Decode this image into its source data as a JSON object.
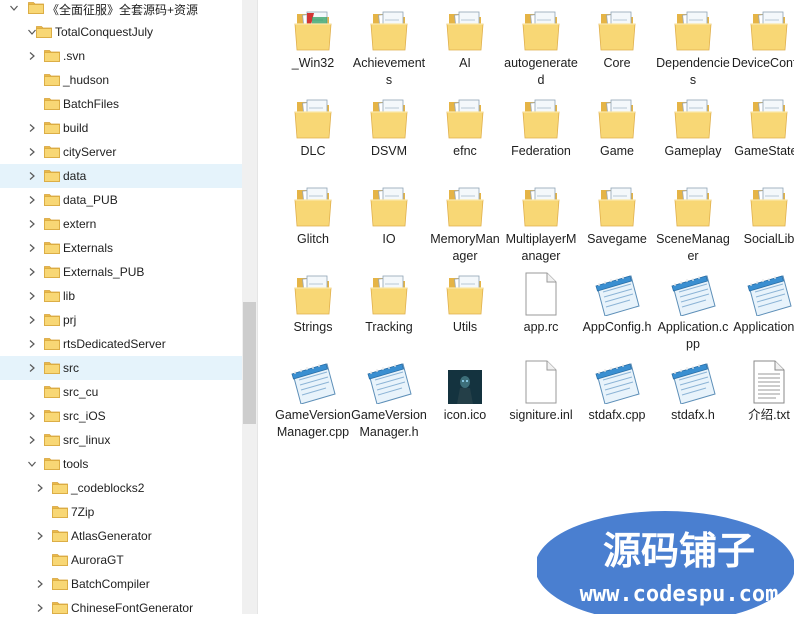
{
  "tree": {
    "items": [
      {
        "label": "《全面征服》全套源码+资源",
        "level": 0,
        "expander": "expanded",
        "selected": false
      },
      {
        "label": "TotalConquestJuly",
        "level": 1,
        "expander": "expanded",
        "selected": false
      },
      {
        "label": ".svn",
        "level": 2,
        "expander": "collapsed",
        "selected": false
      },
      {
        "label": "_hudson",
        "level": 2,
        "expander": "none",
        "selected": false
      },
      {
        "label": "BatchFiles",
        "level": 2,
        "expander": "none",
        "selected": false
      },
      {
        "label": "build",
        "level": 2,
        "expander": "collapsed",
        "selected": false
      },
      {
        "label": "cityServer",
        "level": 2,
        "expander": "collapsed",
        "selected": false
      },
      {
        "label": "data",
        "level": 2,
        "expander": "collapsed",
        "selected": true
      },
      {
        "label": "data_PUB",
        "level": 2,
        "expander": "collapsed",
        "selected": false
      },
      {
        "label": "extern",
        "level": 2,
        "expander": "collapsed",
        "selected": false
      },
      {
        "label": "Externals",
        "level": 2,
        "expander": "collapsed",
        "selected": false
      },
      {
        "label": "Externals_PUB",
        "level": 2,
        "expander": "collapsed",
        "selected": false
      },
      {
        "label": "lib",
        "level": 2,
        "expander": "collapsed",
        "selected": false
      },
      {
        "label": "prj",
        "level": 2,
        "expander": "collapsed",
        "selected": false
      },
      {
        "label": "rtsDedicatedServer",
        "level": 2,
        "expander": "collapsed",
        "selected": false
      },
      {
        "label": "src",
        "level": 2,
        "expander": "collapsed",
        "selected": true
      },
      {
        "label": "src_cu",
        "level": 2,
        "expander": "none",
        "selected": false
      },
      {
        "label": "src_iOS",
        "level": 2,
        "expander": "collapsed",
        "selected": false
      },
      {
        "label": "src_linux",
        "level": 2,
        "expander": "collapsed",
        "selected": false
      },
      {
        "label": "tools",
        "level": 2,
        "expander": "expanded",
        "selected": false
      },
      {
        "label": "_codeblocks2",
        "level": 3,
        "expander": "collapsed",
        "selected": false
      },
      {
        "label": "7Zip",
        "level": 3,
        "expander": "none",
        "selected": false
      },
      {
        "label": "AtlasGenerator",
        "level": 3,
        "expander": "collapsed",
        "selected": false
      },
      {
        "label": "AuroraGT",
        "level": 3,
        "expander": "none",
        "selected": false
      },
      {
        "label": "BatchCompiler",
        "level": 3,
        "expander": "collapsed",
        "selected": false
      },
      {
        "label": "ChineseFontGenerator",
        "level": 3,
        "expander": "collapsed",
        "selected": false
      }
    ]
  },
  "files": [
    {
      "name": "_Win32",
      "icon": "folder-red-doc-icon"
    },
    {
      "name": "Achievements",
      "icon": "folder-icon"
    },
    {
      "name": "AI",
      "icon": "folder-icon"
    },
    {
      "name": "autogenerated",
      "icon": "folder-icon"
    },
    {
      "name": "Core",
      "icon": "folder-icon"
    },
    {
      "name": "Dependencies",
      "icon": "folder-icon"
    },
    {
      "name": "DeviceConfig",
      "icon": "folder-icon"
    },
    {
      "name": "DLC",
      "icon": "folder-icon"
    },
    {
      "name": "DSVM",
      "icon": "folder-icon"
    },
    {
      "name": "efnc",
      "icon": "folder-icon"
    },
    {
      "name": "Federation",
      "icon": "folder-icon"
    },
    {
      "name": "Game",
      "icon": "folder-icon"
    },
    {
      "name": "Gameplay",
      "icon": "folder-icon"
    },
    {
      "name": "GameStates",
      "icon": "folder-icon"
    },
    {
      "name": "Glitch",
      "icon": "folder-icon"
    },
    {
      "name": "IO",
      "icon": "folder-icon"
    },
    {
      "name": "MemoryManager",
      "icon": "folder-icon"
    },
    {
      "name": "MultiplayerManager",
      "icon": "folder-icon"
    },
    {
      "name": "Savegame",
      "icon": "folder-icon"
    },
    {
      "name": "SceneManager",
      "icon": "folder-icon"
    },
    {
      "name": "SocialLib",
      "icon": "folder-icon"
    },
    {
      "name": "Strings",
      "icon": "folder-icon"
    },
    {
      "name": "Tracking",
      "icon": "folder-icon"
    },
    {
      "name": "Utils",
      "icon": "folder-icon"
    },
    {
      "name": "app.rc",
      "icon": "blank-file-icon"
    },
    {
      "name": "AppConfig.h",
      "icon": "notepad-file-icon"
    },
    {
      "name": "Application.cpp",
      "icon": "notepad-file-icon"
    },
    {
      "name": "Application.h",
      "icon": "notepad-file-icon"
    },
    {
      "name": "GameVersionManager.cpp",
      "icon": "notepad-file-icon"
    },
    {
      "name": "GameVersionManager.h",
      "icon": "notepad-file-icon"
    },
    {
      "name": "icon.ico",
      "icon": "image-file-icon"
    },
    {
      "name": "signiture.inl",
      "icon": "blank-file-icon"
    },
    {
      "name": "stdafx.cpp",
      "icon": "notepad-file-icon"
    },
    {
      "name": "stdafx.h",
      "icon": "notepad-file-icon"
    },
    {
      "name": "介绍.txt",
      "icon": "text-file-icon"
    }
  ],
  "watermark": {
    "title": "源码铺子",
    "url": "www.codespu.com",
    "color": "#4a7fd0"
  },
  "colors": {
    "selection": "#e5f3fb",
    "folder": "#f8d775"
  }
}
